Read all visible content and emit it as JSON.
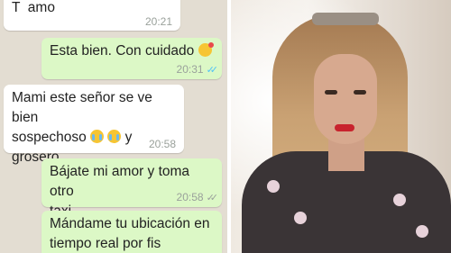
{
  "messages": [
    {
      "text": "T  amo",
      "time": "20:21",
      "direction": "in"
    },
    {
      "text": "Esta bien. Con cuidado",
      "emoji": "face-blowing-kiss",
      "time": "20:31",
      "direction": "out",
      "status": "read"
    },
    {
      "text_lines": [
        "Mami este señor se ve bien",
        "sospechoso",
        "y",
        "grosero"
      ],
      "emoji": "loudly-crying-face x2",
      "time": "20:58",
      "direction": "in"
    },
    {
      "text_lines": [
        "Bájate mi amor y toma otro",
        "taxi."
      ],
      "time": "20:58",
      "direction": "out",
      "status": "delivered"
    },
    {
      "text_lines": [
        "Mándame tu ubicación en",
        "tiempo real por fis"
      ],
      "direction": "out"
    }
  ],
  "colors": {
    "chat_background": "#e3ddd2",
    "incoming_bubble": "#ffffff",
    "outgoing_bubble": "#dcf8c6",
    "read_ticks": "#4fc3f7",
    "timestamp": "#9aa19b"
  },
  "photo": {
    "subject": "selfie-photo"
  }
}
